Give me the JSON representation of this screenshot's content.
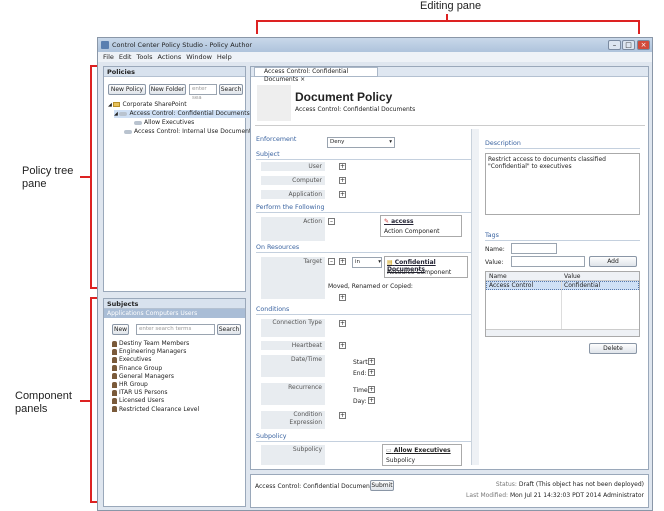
{
  "callouts": {
    "editing_pane": "Editing pane",
    "policy_tree_pane": "Policy tree\npane",
    "component_panels": "Component\npanels"
  },
  "window": {
    "title": "Control Center Policy Studio - Policy Author"
  },
  "menu": [
    "File",
    "Edit",
    "Tools",
    "Actions",
    "Window",
    "Help"
  ],
  "policies": {
    "header": "Policies",
    "new_policy": "New Policy",
    "new_folder": "New Folder",
    "search_placeholder": "enter sea",
    "search": "Search",
    "tree": [
      "Corporate SharePoint",
      "Access Control: Confidential Documents",
      "Allow Executives",
      "Access Control: Internal Use Documents"
    ]
  },
  "subjects": {
    "header": "Subjects",
    "tabs": "Applications  Computers  Users",
    "new": "New",
    "search_placeholder": "enter search terms",
    "search": "Search",
    "items": [
      "Destiny Team Members",
      "Engineering Managers",
      "Executives",
      "Finance Group",
      "General Managers",
      "HR Group",
      "ITAR US Persons",
      "Licensed Users",
      "Restricted Clearance Level"
    ]
  },
  "editor": {
    "tab": "Access Control: Confidential Documents",
    "title": "Document Policy",
    "subtitle": "Access Control: Confidential Documents",
    "enforcement_label": "Enforcement",
    "enforcement_value": "Deny",
    "subject_section": "Subject",
    "user": "User",
    "computer": "Computer",
    "application": "Application",
    "perform_section": "Perform the Following",
    "action": "Action",
    "action_name": "access",
    "action_type": "Action Component",
    "resource_section": "On Resources",
    "target": "Target",
    "target_op": "in",
    "resource_name": "Confidential Documents",
    "resource_type": "Resource Component",
    "moved": "Moved, Renamed or Copied:",
    "conditions_section": "Conditions",
    "connection_type": "Connection Type",
    "heartbeat": "Heartbeat",
    "datetime": "Date/Time",
    "start": "Start:",
    "end": "End:",
    "recurrence": "Recurrence",
    "time": "Time:",
    "day": "Day:",
    "cond_expr": "Condition Expression",
    "subpolicy_section": "Subpolicy",
    "subpolicy": "Subpolicy",
    "sub_name": "Allow Executives",
    "sub_type": "Subpolicy"
  },
  "right": {
    "description_label": "Description",
    "description": "Restrict access to documents classified \"Confidential\" to executives",
    "tags_label": "Tags",
    "name": "Name:",
    "value": "Value:",
    "add": "Add",
    "col_name": "Name",
    "col_value": "Value",
    "row_name": "Access Control",
    "row_value": "Confidential",
    "delete": "Delete"
  },
  "footer": {
    "policy": "Access Control: Confidential Documents",
    "submit": "Submit",
    "status_label": "Status:",
    "status": "Draft (This object has not been deployed)",
    "modified_label": "Last Modified:",
    "modified": "Mon Jul 21 14:32:03 PDT 2014 Administrator"
  }
}
